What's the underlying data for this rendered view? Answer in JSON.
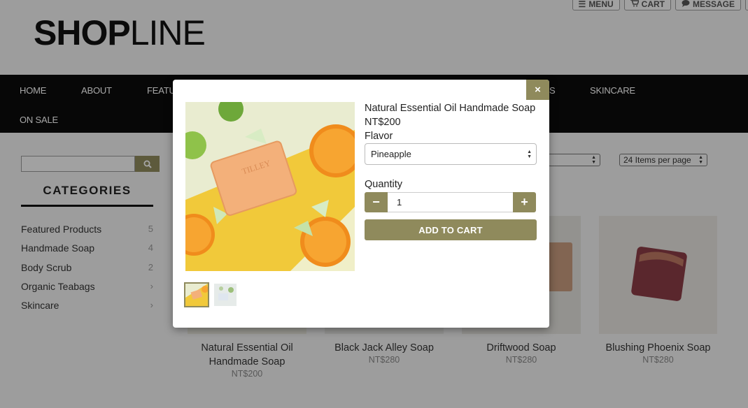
{
  "header": {
    "logo_bold": "SHOP",
    "logo_light": "LINE",
    "top_buttons": [
      {
        "label": "MENU",
        "icon": "menu-icon"
      },
      {
        "label": "CART",
        "icon": "cart-icon"
      },
      {
        "label": "MESSAGE",
        "icon": "chat-icon"
      }
    ]
  },
  "nav": {
    "items": [
      "HOME",
      "ABOUT",
      "FEATU",
      "S",
      "SKINCARE",
      "ON SALE"
    ]
  },
  "sidebar": {
    "search_placeholder": "",
    "categories_title": "CATEGORIES",
    "categories": [
      {
        "label": "Featured Products",
        "count": "5"
      },
      {
        "label": "Handmade Soap",
        "count": "4"
      },
      {
        "label": "Body Scrub",
        "count": "2"
      },
      {
        "label": "Organic Teabags",
        "count": "›"
      },
      {
        "label": "Skincare",
        "count": "›"
      }
    ]
  },
  "toolbar": {
    "sort_value": "",
    "per_page_value": "24 Items per page"
  },
  "products": [
    {
      "name": "Natural Essential Oil Handmade Soap",
      "price": "NT$200"
    },
    {
      "name": "Black Jack Alley Soap",
      "price": "NT$280"
    },
    {
      "name": "Driftwood Soap",
      "price": "NT$280"
    },
    {
      "name": "Blushing Phoenix Soap",
      "price": "NT$280"
    }
  ],
  "modal": {
    "close_label": "×",
    "title": "Natural Essential Oil Handmade Soap",
    "price": "NT$200",
    "flavor_label": "Flavor",
    "flavor_value": "Pineapple",
    "quantity_label": "Quantity",
    "quantity_value": "1",
    "minus_label": "−",
    "plus_label": "+",
    "add_to_cart_label": "ADD TO CART",
    "soap_brand": "TILLEY"
  },
  "colors": {
    "accent": "#8f8a5c",
    "nav_bg": "#0c0c0c",
    "page_bg": "#f1f1f1"
  }
}
